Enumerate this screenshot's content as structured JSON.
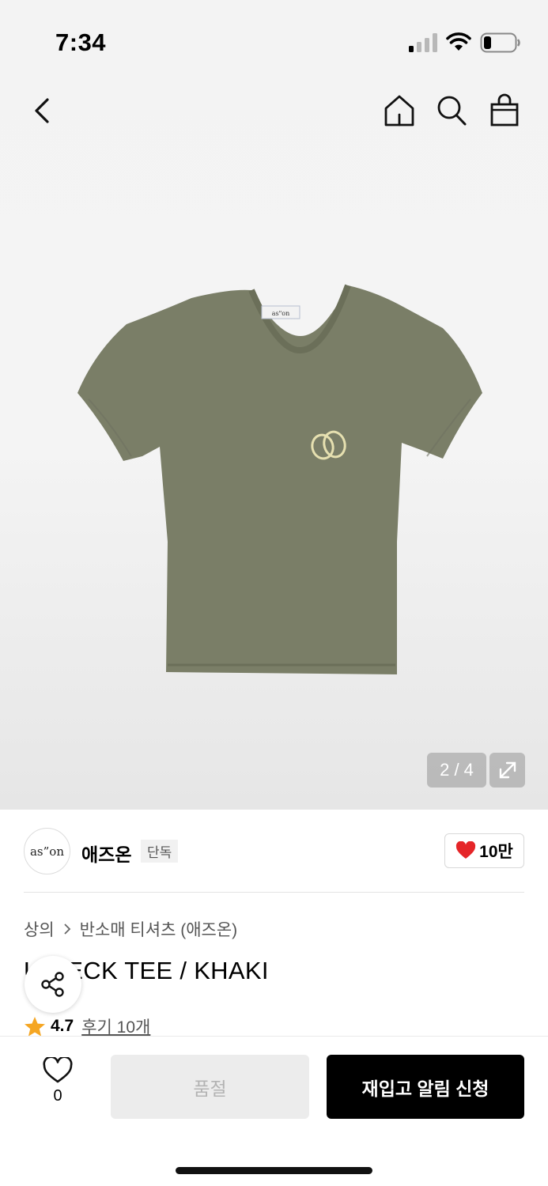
{
  "status": {
    "time": "7:34"
  },
  "product": {
    "image_pager": "2 / 4",
    "image_print_text": "as\"on",
    "brand_logo_text": "as”on",
    "brand_name": "애즈온",
    "brand_badge": "단독",
    "likes": "10만",
    "breadcrumb": [
      "상의",
      "반소매 티셔츠 (애즈온)"
    ],
    "title": "U NECK TEE / KHAKI",
    "rating": "4.7",
    "reviews": "후기 10개",
    "shirt_color": "#7a7e67",
    "print_color": "#e6e0b0"
  },
  "bottom": {
    "wish_count": "0",
    "soldout_label": "품절",
    "restock_label": "재입고 알림 신청"
  },
  "icons": [
    "chevron-left-icon",
    "home-icon",
    "search-icon",
    "shopping-bag-icon",
    "expand-icon",
    "heart-icon",
    "share-icon",
    "star-icon"
  ],
  "colors": {
    "accent_heart": "#e52528",
    "star": "#f5a623",
    "primary_button": "#000000"
  }
}
